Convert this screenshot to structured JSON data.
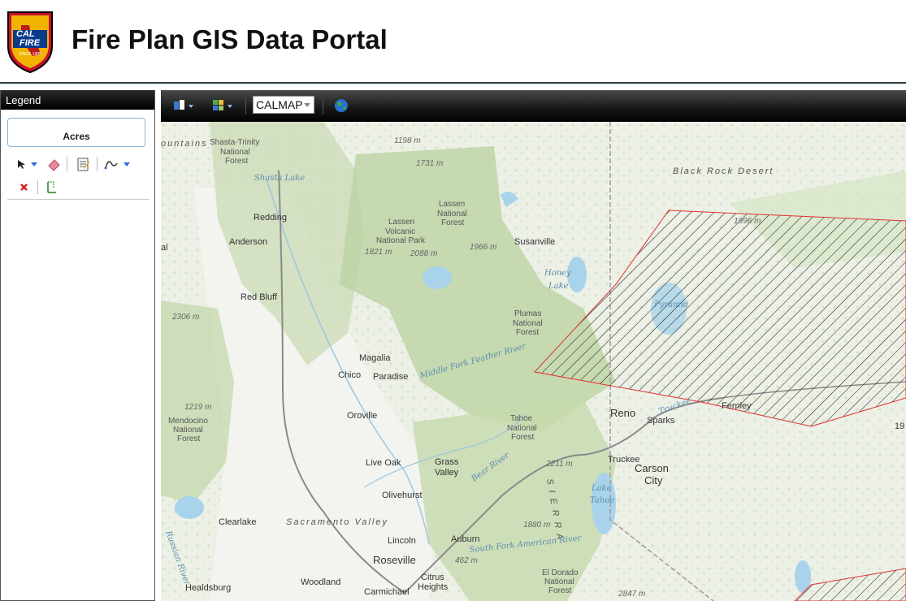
{
  "header": {
    "title": "Fire Plan GIS Data Portal",
    "logo": {
      "text_top": "CAL",
      "text_bottom": "FIRE",
      "since": "SINCE 1885"
    }
  },
  "legend": {
    "title": "Legend",
    "acres_label": "Acres",
    "tools": [
      "select-arrow-icon",
      "eraser-icon",
      "notes-icon",
      "freehand-line-icon",
      "delete-icon",
      "measure-icon"
    ]
  },
  "toolbar": {
    "basemap_value": "CALMAP",
    "icons": [
      "bookmarks-icon",
      "basemap-gallery-icon",
      "globe-icon"
    ]
  },
  "map": {
    "places": [
      {
        "name": "Redding"
      },
      {
        "name": "Anderson"
      },
      {
        "name": "Red Bluff"
      },
      {
        "name": "Susanville"
      },
      {
        "name": "Magalia"
      },
      {
        "name": "Chico"
      },
      {
        "name": "Paradise"
      },
      {
        "name": "Oroville"
      },
      {
        "name": "Live Oak"
      },
      {
        "name": "Grass"
      },
      {
        "name": "Valley"
      },
      {
        "name": "Olivehurst"
      },
      {
        "name": "Clearlake"
      },
      {
        "name": "Lincoln"
      },
      {
        "name": "Auburn"
      },
      {
        "name": "Roseville"
      },
      {
        "name": "Woodland"
      },
      {
        "name": "Healdsburg"
      },
      {
        "name": "Carmichael"
      },
      {
        "name": "Citrus"
      },
      {
        "name": "Heights"
      },
      {
        "name": "Truckee"
      },
      {
        "name": "Reno"
      },
      {
        "name": "Sparks"
      },
      {
        "name": "Fernley"
      },
      {
        "name": "Carson"
      },
      {
        "name": "City"
      }
    ],
    "forests": [
      "Shasta-Trinity",
      "National",
      "Forest",
      "Lassen",
      "National",
      "Forest",
      "Lassen",
      "Volcanic",
      "National Park",
      "Plumas",
      "National",
      "Forest",
      "Tahoe",
      "National",
      "Forest",
      "Mendocino",
      "National",
      "Forest",
      "El Dorado",
      "National",
      "Forest"
    ],
    "elevations": [
      "1198 m",
      "1731 m",
      "1821 m",
      "2088 m",
      "1966 m",
      "2306 m",
      "1219 m",
      "2211 m",
      "1880 m",
      "462 m",
      "2847 m",
      "1996 m"
    ],
    "water": [
      "Shasta Lake",
      "Honey",
      "Lake",
      "Middle Fork Feather River",
      "Bear River",
      "Lake",
      "Tahoe",
      "South Fork American River",
      "Russian River",
      "Truckee",
      "Pyramid"
    ],
    "regions": [
      "Black Rock Desert",
      "Sacramento Valley",
      "ountains",
      "S I E R R A"
    ],
    "edge": [
      "al",
      "19"
    ],
    "colors": {
      "forest_green": "#c8dcb0",
      "terrain_light": "#eef0e8",
      "hatch_red": "#e03030",
      "water": "#a9d3ea"
    }
  }
}
